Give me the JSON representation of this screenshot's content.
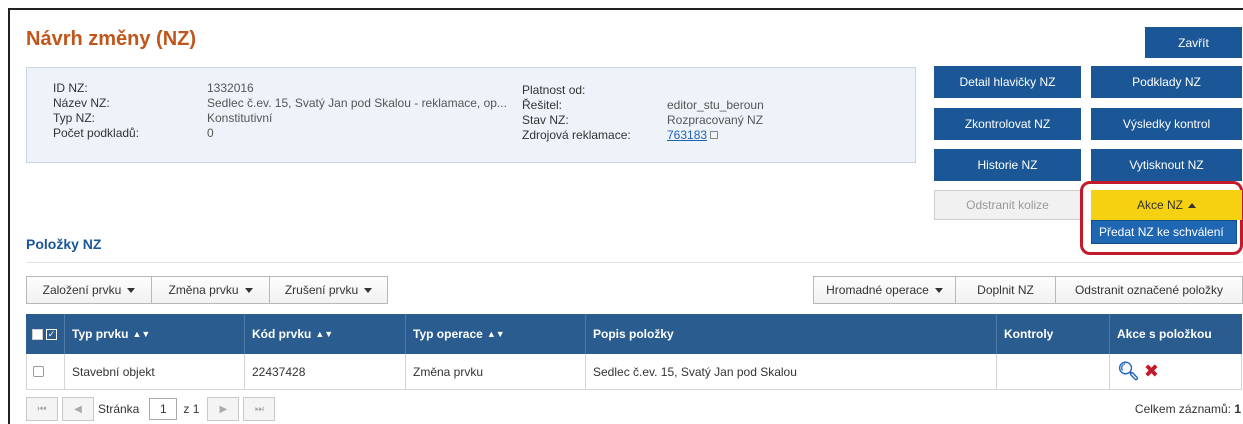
{
  "title": "Návrh změny (NZ)",
  "info": {
    "left": [
      {
        "label": "ID NZ:",
        "value": "1332016"
      },
      {
        "label": "Název NZ:",
        "value": "Sedlec č.ev. 15, Svatý Jan pod Skalou - reklamace, op..."
      },
      {
        "label": "Typ NZ:",
        "value": "Konstitutivní"
      },
      {
        "label": "Počet podkladů:",
        "value": "0"
      }
    ],
    "right": [
      {
        "label": "Platnost od:",
        "value": ""
      },
      {
        "label": "Řešitel:",
        "value": "editor_stu_beroun"
      },
      {
        "label": "Stav NZ:",
        "value": "Rozpracovaný NZ"
      },
      {
        "label": "Zdrojová reklamace:",
        "value": "763183"
      }
    ]
  },
  "buttons": {
    "close": "Zavřít",
    "detail_header": "Detail hlavičky NZ",
    "materials": "Podklady NZ",
    "check": "Zkontrolovat NZ",
    "check_results": "Výsledky kontrol",
    "history": "Historie NZ",
    "print": "Vytisknout NZ",
    "remove_conflict": "Odstranit kolize",
    "actions": "Akce NZ",
    "actions_dropdown_item": "Předat NZ ke schválení"
  },
  "section_title": "Položky NZ",
  "toolbar": {
    "create_element": "Založení prvku",
    "change_element": "Změna prvku",
    "cancel_element": "Zrušení prvku",
    "bulk_operations": "Hromadné operace",
    "complete_nz": "Doplnit NZ",
    "remove_marked": "Odstranit označené položky"
  },
  "table": {
    "columns": [
      "Typ prvku",
      "Kód prvku",
      "Typ operace",
      "Popis položky",
      "Kontroly",
      "Akce s položkou"
    ],
    "rows": [
      {
        "type": "Stavební objekt",
        "code": "22437428",
        "operation": "Změna prvku",
        "description": "Sedlec č.ev. 15, Svatý Jan pod Skalou",
        "checks": ""
      }
    ]
  },
  "pager": {
    "page_label": "Stránka",
    "page": "1",
    "of_label": "z 1",
    "total_label": "Celkem záznamů:",
    "total": "1"
  },
  "colors": {
    "primary": "#1b5796",
    "title": "#c0561a",
    "highlight": "#c4182b",
    "accent_yellow": "#f6d111"
  }
}
